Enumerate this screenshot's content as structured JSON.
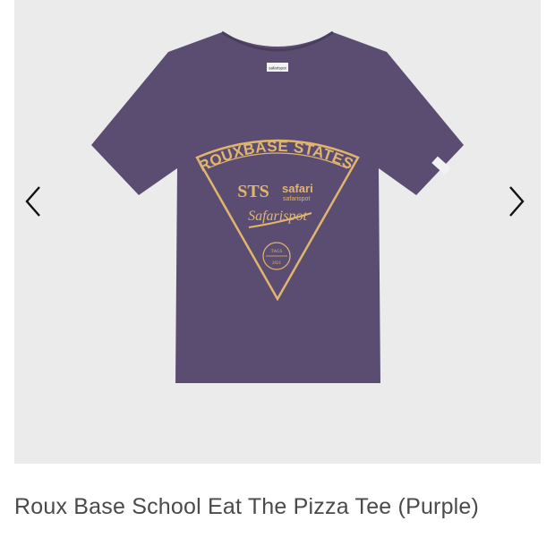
{
  "product": {
    "title": "Roux Base School Eat The Pizza Tee (Purple)",
    "image": {
      "icon": "tshirt-image",
      "shirt_color": "#5b4d72",
      "print_color": "#e0b56d",
      "print_text": {
        "arc": "ROUXBASE STATES.",
        "brand": "safari",
        "brand_sub": "safarispot",
        "script": "Safarispot",
        "badge_top": "TAGS",
        "badge_year": "2021",
        "logo": "STS",
        "label_tag": "safarispot"
      }
    }
  },
  "gallery": {
    "prev_icon": "chevron-left-icon",
    "next_icon": "chevron-right-icon",
    "background": "#ebebeb"
  }
}
